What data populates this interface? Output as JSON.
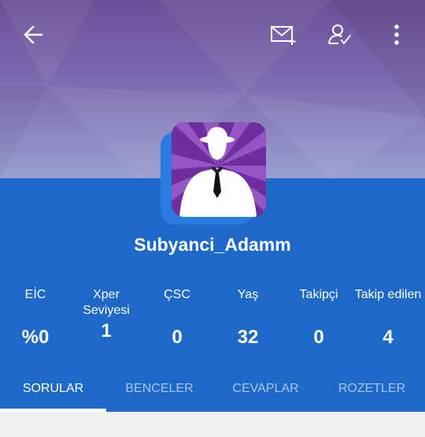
{
  "toolbar": {
    "back_icon": "arrow-left-icon",
    "message_icon": "mail-plus-icon",
    "follow_icon": "user-check-icon",
    "more_icon": "more-vertical-icon"
  },
  "profile": {
    "username": "Subyanci_Adamm",
    "avatar_icon": "anonymous-man-silhouette"
  },
  "stats": [
    {
      "label": "EİC",
      "value": "%0"
    },
    {
      "label": "Xper\nSeviyesi",
      "value": "1"
    },
    {
      "label": "ÇSC",
      "value": "0"
    },
    {
      "label": "Yaş",
      "value": "32"
    },
    {
      "label": "Takipçi",
      "value": "0"
    },
    {
      "label": "Takip edilen",
      "value": "4"
    }
  ],
  "tabs": [
    {
      "label": "SORULAR",
      "active": true
    },
    {
      "label": "BENCELER",
      "active": false
    },
    {
      "label": "CEVAPLAR",
      "active": false
    },
    {
      "label": "ROZETLER",
      "active": false
    }
  ],
  "colors": {
    "primary": "#1e68c8",
    "tab_inactive": "#a8c6f0",
    "avatar_purple": "#7a3aa8"
  }
}
